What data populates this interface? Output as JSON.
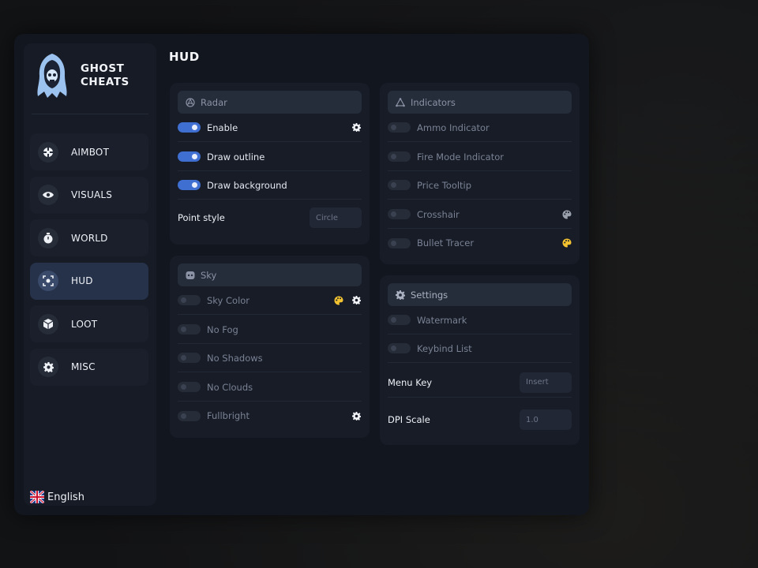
{
  "app": {
    "logo_line1": "GHOST",
    "logo_line2": "CHEATS"
  },
  "sidebar": {
    "items": [
      {
        "label": "AIMBOT",
        "icon": "crosshair-icon",
        "active": false
      },
      {
        "label": "VISUALS",
        "icon": "eye-icon",
        "active": false
      },
      {
        "label": "WORLD",
        "icon": "stopwatch-icon",
        "active": false
      },
      {
        "label": "HUD",
        "icon": "hud-icon",
        "active": true
      },
      {
        "label": "LOOT",
        "icon": "box-icon",
        "active": false
      },
      {
        "label": "MISC",
        "icon": "gear-icon",
        "active": false
      }
    ],
    "language": "English"
  },
  "page": {
    "title": "HUD"
  },
  "radar": {
    "title": "Radar",
    "enable": {
      "label": "Enable",
      "on": true
    },
    "draw_outline": {
      "label": "Draw outline",
      "on": true
    },
    "draw_background": {
      "label": "Draw background",
      "on": true
    },
    "point_style": {
      "label": "Point style",
      "value": "Circle"
    }
  },
  "sky": {
    "title": "Sky",
    "items": [
      {
        "label": "Sky Color",
        "on": false
      },
      {
        "label": "No Fog",
        "on": false
      },
      {
        "label": "No Shadows",
        "on": false
      },
      {
        "label": "No Clouds",
        "on": false
      },
      {
        "label": "Fullbright",
        "on": false
      }
    ]
  },
  "indicators": {
    "title": "Indicators",
    "items": [
      {
        "label": "Ammo Indicator",
        "on": false
      },
      {
        "label": "Fire Mode Indicator",
        "on": false
      },
      {
        "label": "Price Tooltip",
        "on": false
      },
      {
        "label": "Crosshair",
        "on": false
      },
      {
        "label": "Bullet Tracer",
        "on": false
      }
    ]
  },
  "settings": {
    "title": "Settings",
    "watermark": {
      "label": "Watermark",
      "on": false
    },
    "keybind_list": {
      "label": "Keybind List",
      "on": false
    },
    "menu_key": {
      "label": "Menu Key",
      "value": "Insert"
    },
    "dpi_scale": {
      "label": "DPI Scale",
      "value": "1.0"
    }
  },
  "colors": {
    "accent": "#3f6fd0",
    "palette_yellow": "#f2c230",
    "palette_gray": "#9aa0ab"
  }
}
